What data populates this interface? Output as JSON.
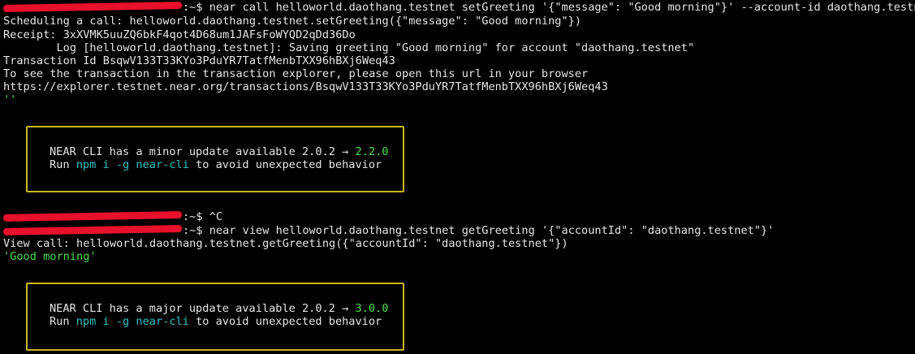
{
  "prompt_suffix": ":~$",
  "lines": {
    "cmd1": " near call helloworld.daothang.testnet setGreeting '{\"message\": \"Good morning\"}' --account-id daothang.testnet",
    "scheduling": "Scheduling a call: helloworld.daothang.testnet.setGreeting({\"message\": \"Good morning\"})",
    "receipt": "Receipt: 3xXVMK5uuZQ6bkF4qot4D68um1JAFsFoWYQD2qDd36Do",
    "log": "        Log [helloworld.daothang.testnet]: Saving greeting \"Good morning\" for account \"daothang.testnet\"",
    "txid": "Transaction Id BsqwV133T33KYo3PduYR7TatfMenbTXX96hBXj6Weq43",
    "explorer_hint": "To see the transaction in the transaction explorer, please open this url in your browser",
    "explorer_url": "https://explorer.testnet.near.org/transactions/BsqwV133T33KYo3PduYR7TatfMenbTXX96hBXj6Weq43",
    "empty_result": "''",
    "cmd2": " ^C",
    "cmd3": " near view helloworld.daothang.testnet getGreeting '{\"accountId\": \"daothang.testnet\"}'",
    "view_call": "View call: helloworld.daothang.testnet.getGreeting({\"accountId\": \"daothang.testnet\"})",
    "view_result": "'Good morning'"
  },
  "update_boxes": [
    {
      "prefix": "NEAR CLI has a minor update available 2.0.2 → ",
      "version": "2.2.0",
      "run": "Run ",
      "cmd": "npm i -g near-cli",
      "suffix": " to avoid unexpected behavior"
    },
    {
      "prefix": "NEAR CLI has a major update available 2.0.2 → ",
      "version": "3.0.0",
      "run": "Run ",
      "cmd": "npm i -g near-cli",
      "suffix": " to avoid unexpected behavior"
    }
  ]
}
